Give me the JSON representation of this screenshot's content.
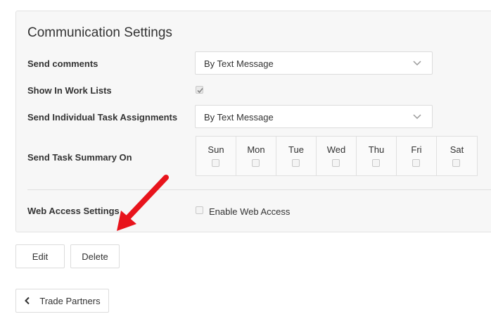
{
  "panel": {
    "title": "Communication Settings",
    "rows": {
      "send_comments": {
        "label": "Send comments",
        "value": "By Text Message"
      },
      "show_in_work_lists": {
        "label": "Show In Work Lists",
        "checked": true
      },
      "send_individual": {
        "label": "Send Individual Task Assignments",
        "value": "By Text Message"
      },
      "task_summary": {
        "label": "Send Task Summary On",
        "days": [
          "Sun",
          "Mon",
          "Tue",
          "Wed",
          "Thu",
          "Fri",
          "Sat"
        ]
      },
      "web_access": {
        "label": "Web Access Settings",
        "checkbox_label": "Enable Web Access",
        "checked": false
      }
    }
  },
  "actions": {
    "edit": "Edit",
    "delete": "Delete"
  },
  "back": {
    "label": "Trade Partners",
    "icon": "chevron-left-icon"
  },
  "annotation": {
    "color": "#e8141c",
    "icon": "red-arrow-icon"
  }
}
